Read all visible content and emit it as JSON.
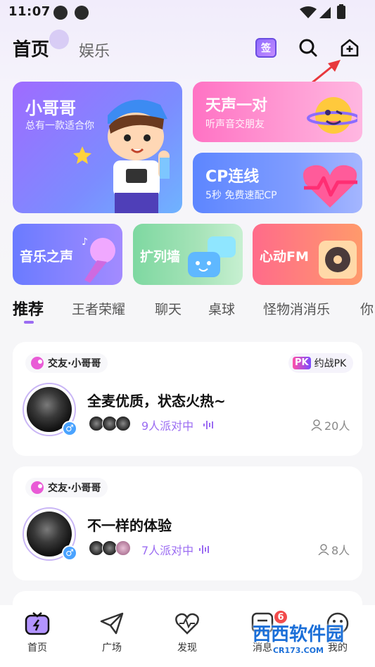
{
  "status_bar": {
    "time": "11:07"
  },
  "header": {
    "tab_home": "首页",
    "tab_entertainment": "娱乐",
    "sign_in_label": "签"
  },
  "banners": {
    "big": {
      "title": "小哥哥",
      "subtitle": "总有一款适合你"
    },
    "voice_pair": {
      "title": "天声一对",
      "subtitle": "听声音交朋友"
    },
    "cp": {
      "title": "CP连线",
      "subtitle": "5秒 免费速配CP"
    },
    "music": {
      "title": "音乐之声"
    },
    "wall": {
      "title": "扩列墙"
    },
    "fm": {
      "title": "心动FM"
    }
  },
  "category_tabs": [
    "推荐",
    "王者荣耀",
    "聊天",
    "桌球",
    "怪物消消乐",
    "你"
  ],
  "rooms": [
    {
      "tag": "交友·小哥哥",
      "pk": "约战PK",
      "pk_badge": "PK",
      "title": "全麦优质，状态火热~",
      "party": "9人派对中",
      "viewers": "20人"
    },
    {
      "tag": "交友·小哥哥",
      "title": "不一样的体验",
      "party": "7人派对中",
      "viewers": "8人"
    }
  ],
  "bottom_nav": {
    "items": [
      {
        "label": "首页"
      },
      {
        "label": "广场"
      },
      {
        "label": "发现"
      },
      {
        "label": "消息"
      },
      {
        "label": "我的"
      }
    ],
    "message_badge": "6"
  },
  "watermark": {
    "text": "西西软件园",
    "sub": "CR173.COM"
  },
  "colors": {
    "accent": "#9b6cf2",
    "badge": "#f24b4b"
  }
}
